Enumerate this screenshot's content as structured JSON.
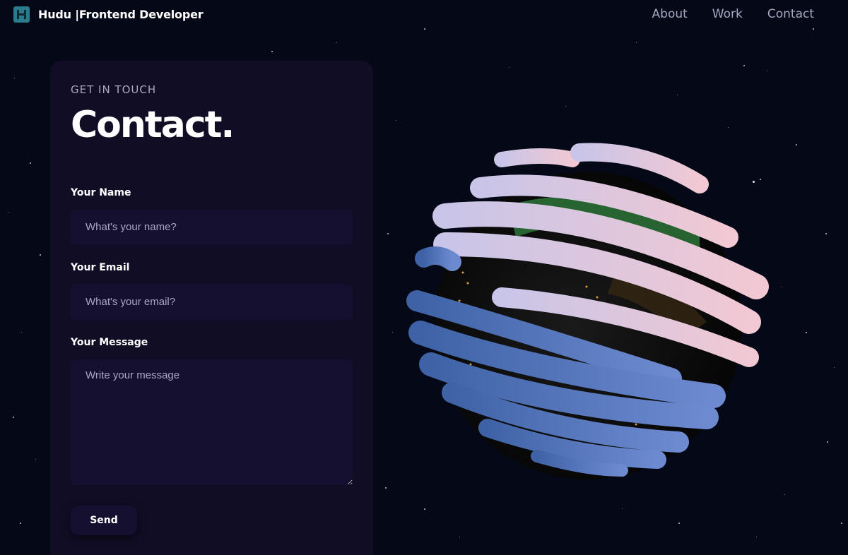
{
  "nav": {
    "brand": "Hudu |Frontend Developer",
    "links": [
      "About",
      "Work",
      "Contact"
    ]
  },
  "contact": {
    "eyebrow": "GET IN TOUCH",
    "heading": "Contact.",
    "name_label": "Your Name",
    "name_placeholder": "What's your name?",
    "email_label": "Your Email",
    "email_placeholder": "What's your email?",
    "message_label": "Your Message",
    "message_placeholder": "Write your message",
    "send_label": "Send"
  },
  "colors": {
    "background": "#050816",
    "card": "#100d25",
    "input": "#151030",
    "secondary_text": "#aaa6c3",
    "logo": "#2b7b8c"
  },
  "icons": {
    "logo": "hudu-h-logo-icon"
  }
}
